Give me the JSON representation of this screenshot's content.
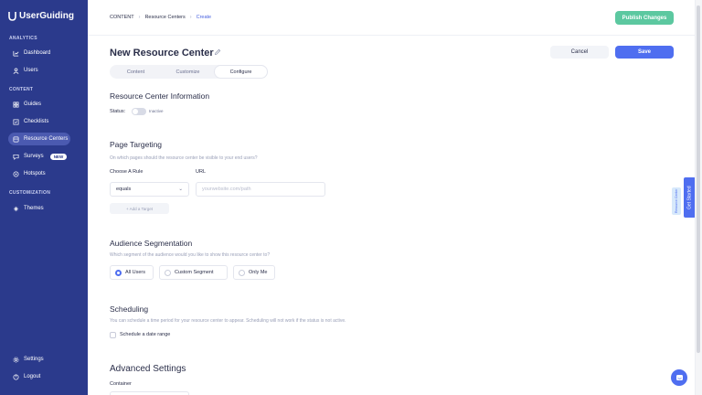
{
  "brand": {
    "name": "UserGuiding"
  },
  "sidebar": {
    "sections": [
      {
        "title": "ANALYTICS"
      },
      {
        "title": "CONTENT"
      },
      {
        "title": "CUSTOMIZATION"
      }
    ],
    "items": [
      {
        "label": "Dashboard",
        "icon": "chart-icon"
      },
      {
        "label": "Users",
        "icon": "user-icon"
      },
      {
        "label": "Guides",
        "icon": "grid-icon"
      },
      {
        "label": "Checklists",
        "icon": "checklist-icon"
      },
      {
        "label": "Resource Centers",
        "icon": "resource-icon",
        "active": true
      },
      {
        "label": "Surveys",
        "icon": "survey-icon",
        "badge": "NEW"
      },
      {
        "label": "Hotspots",
        "icon": "hotspot-icon"
      },
      {
        "label": "Themes",
        "icon": "theme-icon"
      },
      {
        "label": "Settings",
        "icon": "gear-icon"
      },
      {
        "label": "Logout",
        "icon": "logout-icon"
      }
    ]
  },
  "header": {
    "breadcrumb": [
      "CONTENT",
      "Resource Centers",
      "Create"
    ],
    "publish_label": "Publish Changes",
    "title": "New Resource Center",
    "cancel_label": "Cancel",
    "save_label": "Save",
    "tabs": [
      {
        "label": "Content"
      },
      {
        "label": "Customize"
      },
      {
        "label": "Configure",
        "active": true
      }
    ]
  },
  "info": {
    "heading": "Resource Center Information",
    "status_label": "Status:",
    "status_value": "Inactive"
  },
  "targeting": {
    "heading": "Page Targeting",
    "description": "On which pages should the resource center be visible to your end users?",
    "rule_label": "Choose A Rule",
    "url_label": "URL",
    "rule_value": "equals",
    "url_placeholder": "yourwebsite.com/path",
    "add_target_label": "+ Add a Target"
  },
  "audience": {
    "heading": "Audience Segmentation",
    "description": "Which segment of the audience would you like to show this resource center to?",
    "options": [
      "All Users",
      "Custom Segment",
      "Only Me"
    ],
    "selected": "All Users"
  },
  "scheduling": {
    "heading": "Scheduling",
    "description": "You can schedule a time period for your resource center to appear. Scheduling will not work if the status is not active.",
    "checkbox_label": "Schedule a date range"
  },
  "advanced": {
    "heading": "Advanced Settings",
    "container_label": "Container"
  },
  "widgets": {
    "get_started_label": "Get Started",
    "side_tab_label": "Resource Center"
  },
  "colors": {
    "sidebar": "#2b3a8c",
    "accent": "#4f6ef0",
    "publish": "#5cc8a0"
  }
}
